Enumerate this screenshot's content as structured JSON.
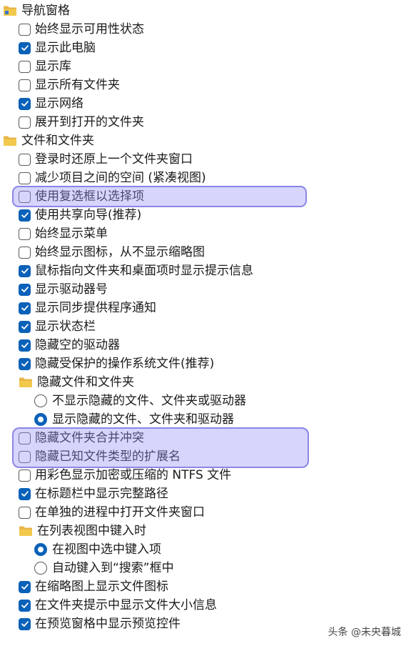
{
  "colors": {
    "accent": "#0a61b8",
    "highlight": "#9691f5",
    "folder": "#f2c94c"
  },
  "rows": [
    {
      "type": "folder",
      "level": 0,
      "label": "导航窗格",
      "icon": "navigation-pane-icon"
    },
    {
      "type": "checkbox",
      "level": 1,
      "label": "始终显示可用性状态",
      "checked": false
    },
    {
      "type": "checkbox",
      "level": 1,
      "label": "显示此电脑",
      "checked": true
    },
    {
      "type": "checkbox",
      "level": 1,
      "label": "显示库",
      "checked": false
    },
    {
      "type": "checkbox",
      "level": 1,
      "label": "显示所有文件夹",
      "checked": false
    },
    {
      "type": "checkbox",
      "level": 1,
      "label": "显示网络",
      "checked": true
    },
    {
      "type": "checkbox",
      "level": 1,
      "label": "展开到打开的文件夹",
      "checked": false
    },
    {
      "type": "folder",
      "level": 0,
      "label": "文件和文件夹",
      "icon": "folder-icon"
    },
    {
      "type": "checkbox",
      "level": 1,
      "label": "登录时还原上一个文件夹窗口",
      "checked": false
    },
    {
      "type": "checkbox",
      "level": 1,
      "label": "减少项目之间的空间 (紧凑视图)",
      "checked": false
    },
    {
      "type": "checkbox",
      "level": 1,
      "label": "使用复选框以选择项",
      "checked": false
    },
    {
      "type": "checkbox",
      "level": 1,
      "label": "使用共享向导(推荐)",
      "checked": true
    },
    {
      "type": "checkbox",
      "level": 1,
      "label": "始终显示菜单",
      "checked": false
    },
    {
      "type": "checkbox",
      "level": 1,
      "label": "始终显示图标，从不显示缩略图",
      "checked": false
    },
    {
      "type": "checkbox",
      "level": 1,
      "label": "鼠标指向文件夹和桌面项时显示提示信息",
      "checked": true
    },
    {
      "type": "checkbox",
      "level": 1,
      "label": "显示驱动器号",
      "checked": true
    },
    {
      "type": "checkbox",
      "level": 1,
      "label": "显示同步提供程序通知",
      "checked": true
    },
    {
      "type": "checkbox",
      "level": 1,
      "label": "显示状态栏",
      "checked": true
    },
    {
      "type": "checkbox",
      "level": 1,
      "label": "隐藏空的驱动器",
      "checked": true
    },
    {
      "type": "checkbox",
      "level": 1,
      "label": "隐藏受保护的操作系统文件(推荐)",
      "checked": true
    },
    {
      "type": "folder",
      "level": 1,
      "label": "隐藏文件和文件夹",
      "icon": "folder-icon"
    },
    {
      "type": "radio",
      "level": 2,
      "label": "不显示隐藏的文件、文件夹或驱动器",
      "checked": false
    },
    {
      "type": "radio",
      "level": 2,
      "label": "显示隐藏的文件、文件夹和驱动器",
      "checked": true
    },
    {
      "type": "checkbox",
      "level": 1,
      "label": "隐藏文件夹合并冲突",
      "checked": false
    },
    {
      "type": "checkbox",
      "level": 1,
      "label": "隐藏已知文件类型的扩展名",
      "checked": false
    },
    {
      "type": "checkbox",
      "level": 1,
      "label": "用彩色显示加密或压缩的 NTFS 文件",
      "checked": false
    },
    {
      "type": "checkbox",
      "level": 1,
      "label": "在标题栏中显示完整路径",
      "checked": true
    },
    {
      "type": "checkbox",
      "level": 1,
      "label": "在单独的进程中打开文件夹窗口",
      "checked": false
    },
    {
      "type": "folder",
      "level": 1,
      "label": "在列表视图中键入时",
      "icon": "folder-icon"
    },
    {
      "type": "radio",
      "level": 2,
      "label": "在视图中选中键入项",
      "checked": true
    },
    {
      "type": "radio",
      "level": 2,
      "label": "自动键入到“搜索”框中",
      "checked": false
    },
    {
      "type": "checkbox",
      "level": 1,
      "label": "在缩略图上显示文件图标",
      "checked": true
    },
    {
      "type": "checkbox",
      "level": 1,
      "label": "在文件夹提示中显示文件大小信息",
      "checked": true
    },
    {
      "type": "checkbox",
      "level": 1,
      "label": "在预览窗格中显示预览控件",
      "checked": true
    }
  ],
  "watermark": {
    "text": "头条 @未央暮城"
  }
}
